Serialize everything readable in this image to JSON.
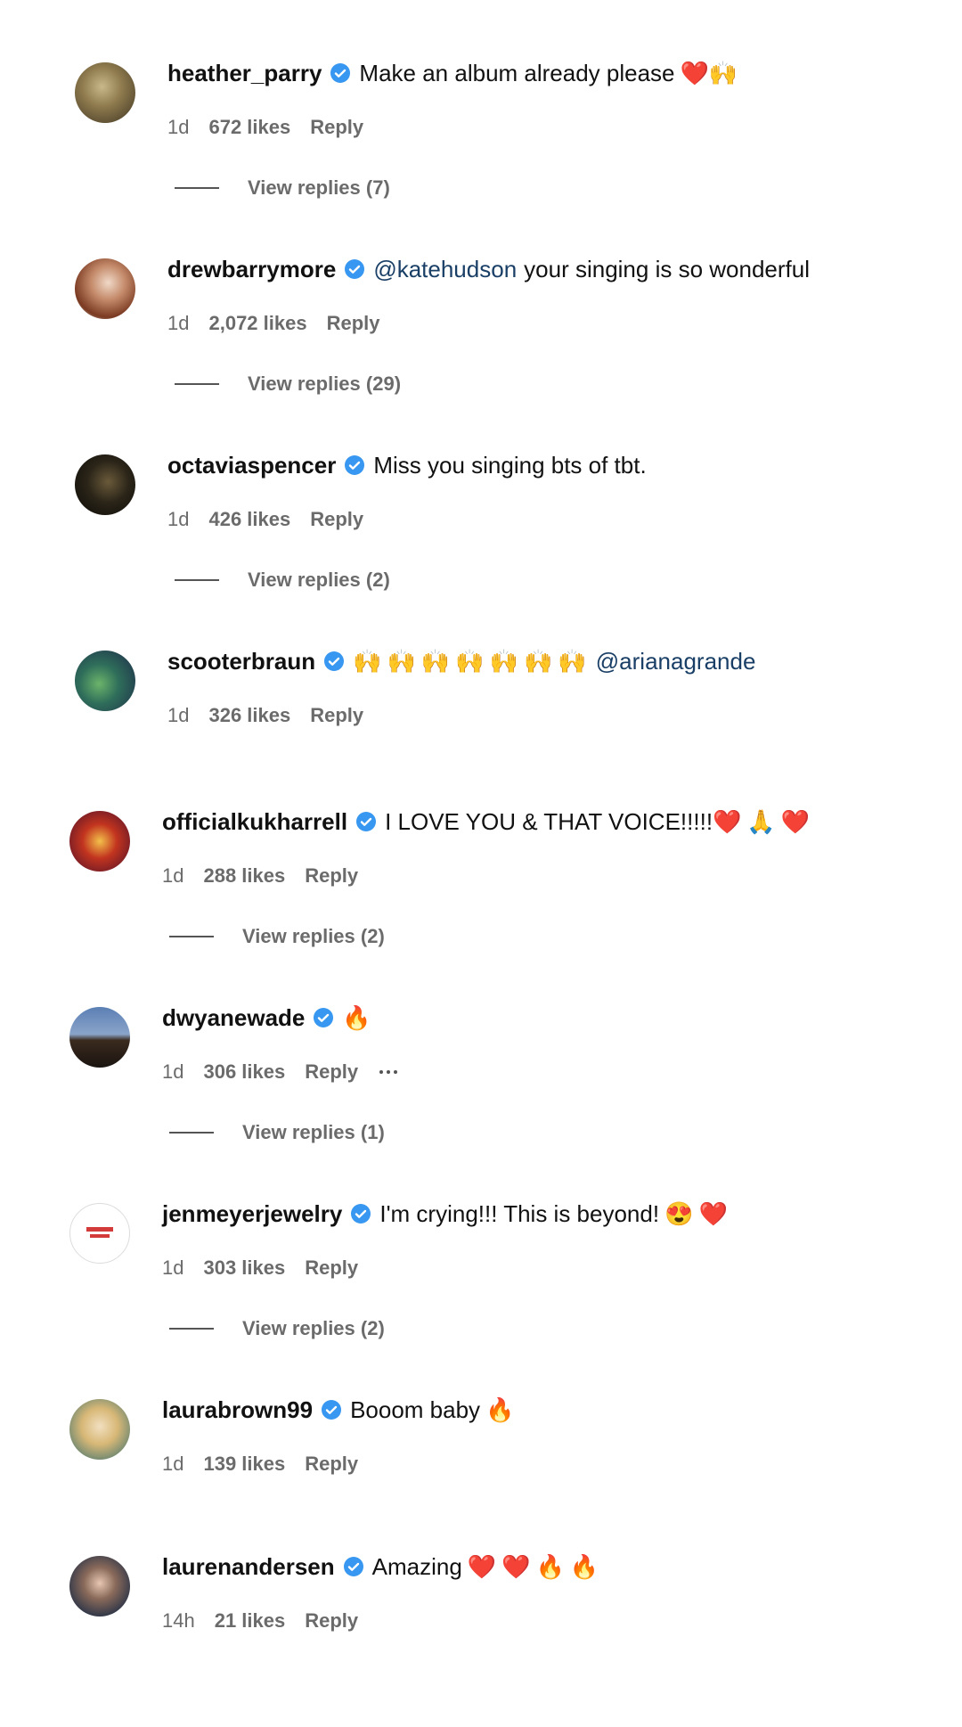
{
  "colors": {
    "verified": "#3897f0",
    "mention": "#1a3f66",
    "meta": "#6b6b6b"
  },
  "comments": [
    {
      "username": "heather_parry",
      "verified": true,
      "text": "Make an album already please",
      "emojis": [
        "❤️",
        "🙌"
      ],
      "time": "1d",
      "likes": "672 likes",
      "reply": "Reply",
      "view_replies": "View replies (7)"
    },
    {
      "username": "drewbarrymore",
      "verified": true,
      "mention": "@katehudson",
      "text": "your singing is so wonderful",
      "time": "1d",
      "likes": "2,072 likes",
      "reply": "Reply",
      "view_replies": "View replies (29)"
    },
    {
      "username": "octaviaspencer",
      "verified": true,
      "text": "Miss you singing bts of tbt.",
      "time": "1d",
      "likes": "426 likes",
      "reply": "Reply",
      "view_replies": "View replies (2)"
    },
    {
      "username": "scooterbraun",
      "verified": true,
      "emojis": [
        "🙌",
        "🙌",
        "🙌",
        "🙌",
        "🙌",
        "🙌",
        "🙌"
      ],
      "mention": "@arianagrande",
      "time": "1d",
      "likes": "326 likes",
      "reply": "Reply"
    },
    {
      "username": "officialkukharrell",
      "verified": true,
      "text": "I LOVE YOU & THAT VOICE!!!!!",
      "emojis": [
        "❤️",
        "🙏",
        "❤️"
      ],
      "time": "1d",
      "likes": "288 likes",
      "reply": "Reply",
      "view_replies": "View replies (2)"
    },
    {
      "username": "dwyanewade",
      "verified": true,
      "emojis": [
        "🔥"
      ],
      "time": "1d",
      "likes": "306 likes",
      "reply": "Reply",
      "more_icon": "more-horizontal-icon",
      "view_replies": "View replies (1)"
    },
    {
      "username": "jenmeyerjewelry",
      "verified": true,
      "text": "I'm crying!!! This is beyond!",
      "emojis": [
        "😍",
        "❤️"
      ],
      "time": "1d",
      "likes": "303 likes",
      "reply": "Reply",
      "view_replies": "View replies (2)"
    },
    {
      "username": "laurabrown99",
      "verified": true,
      "text": "Booom baby",
      "emojis": [
        "🔥"
      ],
      "time": "1d",
      "likes": "139 likes",
      "reply": "Reply"
    },
    {
      "username": "laurenandersen",
      "verified": true,
      "text": "Amazing",
      "emojis": [
        "❤️",
        "❤️",
        "🔥",
        "🔥"
      ],
      "time": "14h",
      "likes": "21 likes",
      "reply": "Reply"
    }
  ]
}
